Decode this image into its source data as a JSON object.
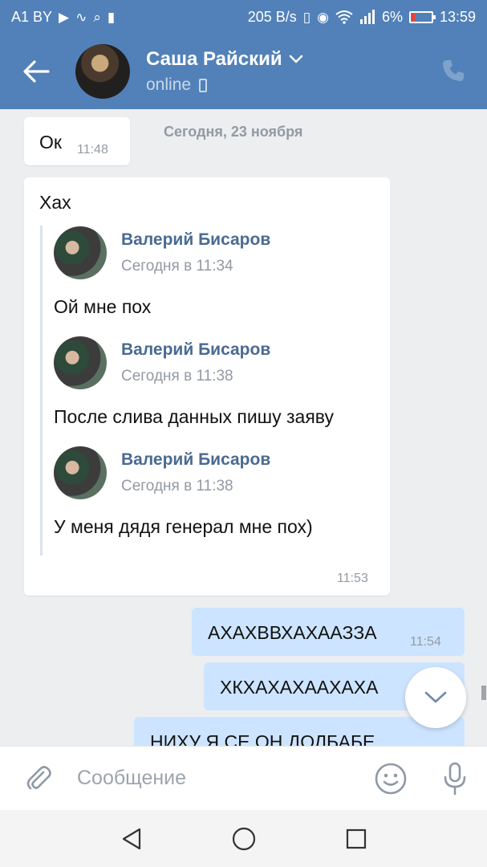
{
  "status_bar": {
    "carrier": "A1 BY",
    "speed": "205 B/s",
    "battery_percent": "6%",
    "time": "13:59"
  },
  "header": {
    "name": "Саша Райский",
    "status": "online"
  },
  "chat": {
    "date_separator": "Сегодня, 23 ноября",
    "msg_ok": {
      "text": "Ок",
      "time": "11:48"
    },
    "msg_reply": {
      "text": "Хах",
      "time": "11:53",
      "forwarded": [
        {
          "author": "Валерий Бисаров",
          "date": "Сегодня в 11:34",
          "text": "Ой мне пох"
        },
        {
          "author": "Валерий Бисаров",
          "date": "Сегодня в 11:38",
          "text": "После слива данных пишу заяву"
        },
        {
          "author": "Валерий Бисаров",
          "date": "Сегодня в 11:38",
          "text": "У меня дядя генерал мне пох)"
        }
      ]
    },
    "out1": {
      "text": "АХАХВВХАХААЗЗА",
      "time": "11:54"
    },
    "out2": {
      "text": "ХКХАХАХААХАХА"
    },
    "out3": {
      "text": "НИХУ Я СЕ ОН ДОЛБАБЕ"
    }
  },
  "input": {
    "placeholder": "Сообщение"
  },
  "colors": {
    "brand": "#5181b8",
    "outgoing_bubble": "#cce4ff",
    "link_name": "#4a6a91"
  }
}
